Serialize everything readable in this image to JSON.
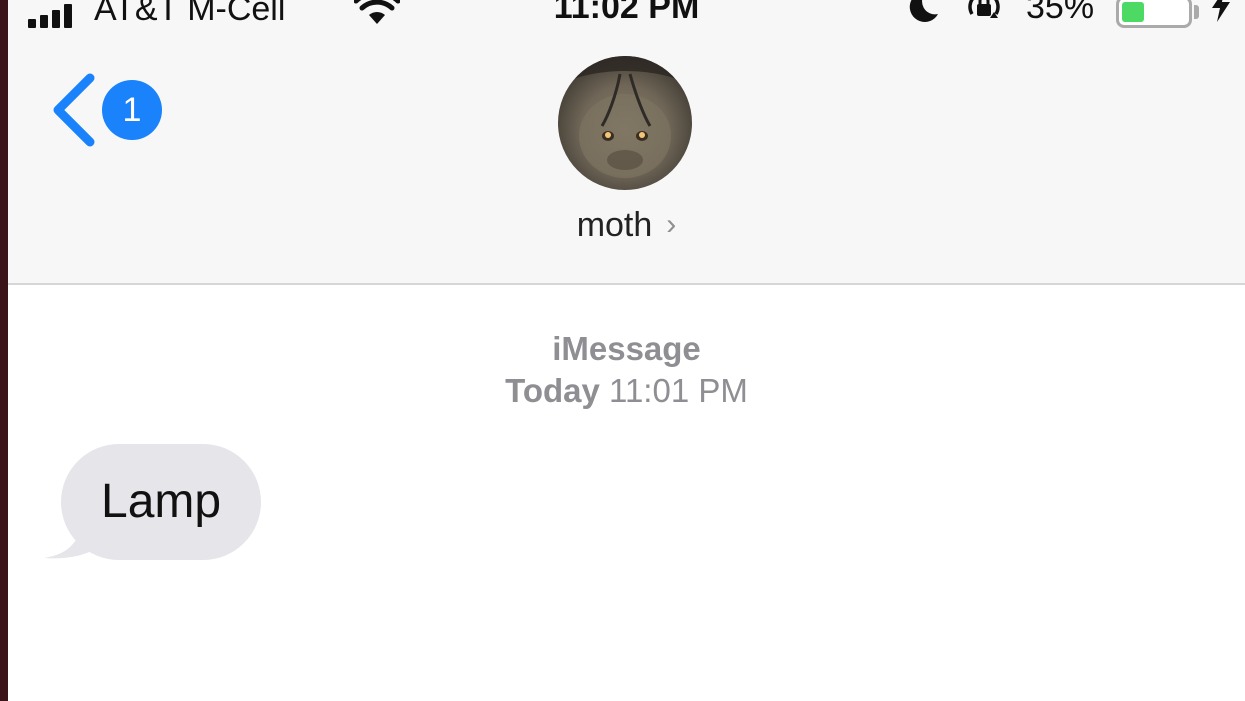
{
  "status_bar": {
    "carrier": "AT&T M-Cell",
    "time": "11:02 PM",
    "battery_percent": "35%",
    "battery_level": 0.35,
    "icons": [
      "signal-icon",
      "wifi-icon",
      "moon-icon",
      "rotation-lock-icon",
      "battery-icon",
      "charging-bolt-icon"
    ]
  },
  "nav": {
    "back_badge": "1",
    "contact_name": "moth",
    "contact_chevron": "›",
    "accent_color": "#1a82fb"
  },
  "conversation": {
    "service": "iMessage",
    "timestamp_day": "Today",
    "timestamp_time": "11:01 PM",
    "messages": [
      {
        "direction": "incoming",
        "text": "Lamp"
      }
    ],
    "bubble_color": "#e5e5ea"
  }
}
